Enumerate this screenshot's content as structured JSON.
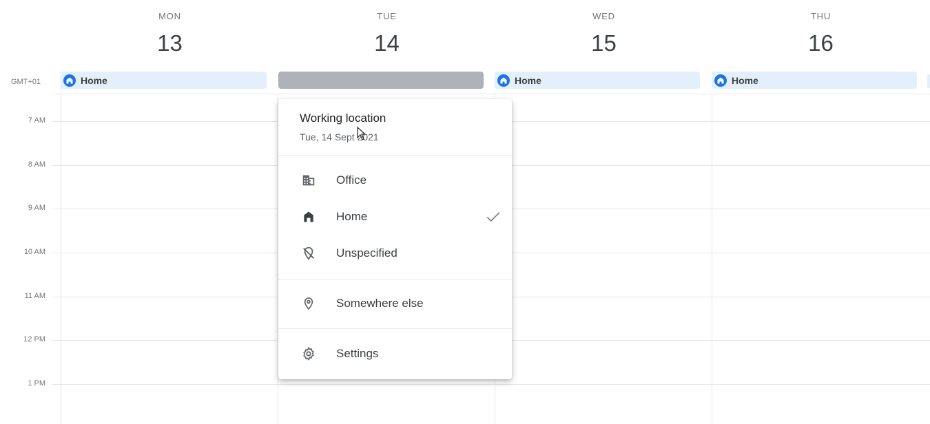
{
  "timezone": "GMT+01",
  "days": [
    {
      "name": "MON",
      "date": "13",
      "location": "Home"
    },
    {
      "name": "TUE",
      "date": "14",
      "location": ""
    },
    {
      "name": "WED",
      "date": "15",
      "location": "Home"
    },
    {
      "name": "THU",
      "date": "16",
      "location": "Home"
    }
  ],
  "hours": [
    "7 AM",
    "8 AM",
    "9 AM",
    "10 AM",
    "11 AM",
    "12 PM",
    "1 PM"
  ],
  "popup": {
    "title": "Working location",
    "subtitle": "Tue, 14 Sept 2021",
    "items": [
      {
        "label": "Office",
        "icon": "office-building-icon",
        "selected": false
      },
      {
        "label": "Home",
        "icon": "home-icon",
        "selected": true
      },
      {
        "label": "Unspecified",
        "icon": "location-off-icon",
        "selected": false
      },
      {
        "label": "Somewhere else",
        "icon": "location-pin-icon",
        "selected": false
      },
      {
        "label": "Settings",
        "icon": "gear-icon",
        "selected": false
      }
    ]
  },
  "colors": {
    "accent": "#1a73e8",
    "chip_bg": "#e3f0fb",
    "selected_chip": "#aeb2b8"
  }
}
